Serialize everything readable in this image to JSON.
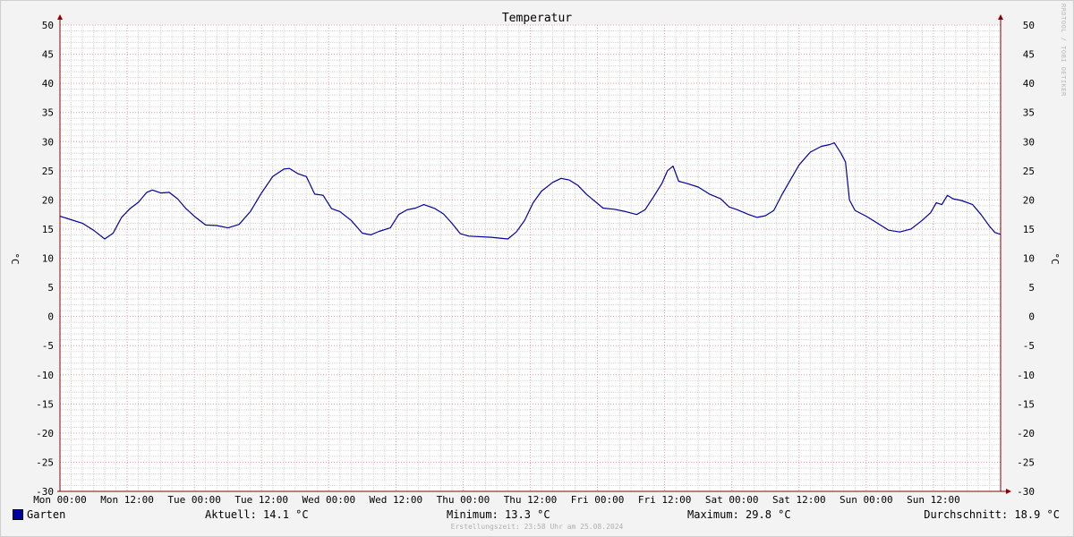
{
  "colors": {
    "background": "#f3f3f3",
    "plot_bg": "#ffffff",
    "line": "#0000a0",
    "grid_major": "#e8a0a0",
    "grid_minor": "#d8d8d8",
    "axis": "#8b0000"
  },
  "credit": "RRDTOOL / TOBI OETIKER",
  "footer": "Erstellungszeit: 23:58 Uhr am 25.08.2024",
  "legend": {
    "series_name": "Garten",
    "current": "Aktuell: 14.1 °C",
    "minimum": "Minimum: 13.3 °C",
    "maximum": "Maximum: 29.8 °C",
    "average": "Durchschnitt: 18.9 °C"
  },
  "chart_data": {
    "type": "line",
    "title": "Temperatur",
    "ylabel_left": "°C",
    "ylabel_right": "°C",
    "ylim": [
      -30,
      50
    ],
    "ytick_step": 5,
    "xlim": [
      0,
      168
    ],
    "x_unit": "hours since Mon 00:00",
    "xticks": [
      {
        "x": 0,
        "label": "Mon 00:00"
      },
      {
        "x": 12,
        "label": "Mon 12:00"
      },
      {
        "x": 24,
        "label": "Tue 00:00"
      },
      {
        "x": 36,
        "label": "Tue 12:00"
      },
      {
        "x": 48,
        "label": "Wed 00:00"
      },
      {
        "x": 60,
        "label": "Wed 12:00"
      },
      {
        "x": 72,
        "label": "Thu 00:00"
      },
      {
        "x": 84,
        "label": "Thu 12:00"
      },
      {
        "x": 96,
        "label": "Fri 00:00"
      },
      {
        "x": 108,
        "label": "Fri 12:00"
      },
      {
        "x": 120,
        "label": "Sat 00:00"
      },
      {
        "x": 132,
        "label": "Sat 12:00"
      },
      {
        "x": 144,
        "label": "Sun 00:00"
      },
      {
        "x": 156,
        "label": "Sun 12:00"
      }
    ],
    "grid": true,
    "series": [
      {
        "name": "Garten",
        "points": [
          [
            0,
            17.2
          ],
          [
            2,
            16.6
          ],
          [
            4,
            16.0
          ],
          [
            6,
            14.8
          ],
          [
            8,
            13.3
          ],
          [
            9.5,
            14.3
          ],
          [
            11,
            17.0
          ],
          [
            12.5,
            18.5
          ],
          [
            14,
            19.6
          ],
          [
            15.5,
            21.3
          ],
          [
            16.5,
            21.7
          ],
          [
            18,
            21.2
          ],
          [
            19.5,
            21.3
          ],
          [
            21,
            20.2
          ],
          [
            22.5,
            18.5
          ],
          [
            24,
            17.2
          ],
          [
            26,
            15.7
          ],
          [
            28,
            15.6
          ],
          [
            30,
            15.2
          ],
          [
            32,
            15.8
          ],
          [
            34,
            18.0
          ],
          [
            36,
            21.2
          ],
          [
            38,
            24.0
          ],
          [
            40,
            25.3
          ],
          [
            41,
            25.4
          ],
          [
            42.5,
            24.5
          ],
          [
            44,
            24.0
          ],
          [
            45.5,
            21.0
          ],
          [
            47,
            20.8
          ],
          [
            48.5,
            18.5
          ],
          [
            50,
            18.0
          ],
          [
            52,
            16.5
          ],
          [
            54,
            14.3
          ],
          [
            55.5,
            14.0
          ],
          [
            57,
            14.6
          ],
          [
            59,
            15.2
          ],
          [
            60.5,
            17.5
          ],
          [
            62,
            18.3
          ],
          [
            63.5,
            18.6
          ],
          [
            65,
            19.2
          ],
          [
            67,
            18.5
          ],
          [
            68.5,
            17.6
          ],
          [
            70,
            16.0
          ],
          [
            71.5,
            14.2
          ],
          [
            73,
            13.8
          ],
          [
            77,
            13.6
          ],
          [
            80,
            13.3
          ],
          [
            81.5,
            14.5
          ],
          [
            83,
            16.5
          ],
          [
            84.5,
            19.5
          ],
          [
            86,
            21.5
          ],
          [
            88,
            23.0
          ],
          [
            89.5,
            23.7
          ],
          [
            91,
            23.4
          ],
          [
            92.5,
            22.5
          ],
          [
            94,
            21.0
          ],
          [
            95.5,
            19.8
          ],
          [
            97,
            18.6
          ],
          [
            99,
            18.4
          ],
          [
            101,
            18.0
          ],
          [
            103,
            17.5
          ],
          [
            104.5,
            18.3
          ],
          [
            106,
            20.5
          ],
          [
            107.5,
            22.8
          ],
          [
            108.5,
            25.0
          ],
          [
            109.5,
            25.8
          ],
          [
            110.5,
            23.2
          ],
          [
            112,
            22.8
          ],
          [
            114,
            22.2
          ],
          [
            116,
            21.0
          ],
          [
            118,
            20.2
          ],
          [
            119.5,
            18.8
          ],
          [
            121,
            18.3
          ],
          [
            123,
            17.5
          ],
          [
            124.5,
            17.0
          ],
          [
            126,
            17.3
          ],
          [
            127.5,
            18.2
          ],
          [
            129,
            21.0
          ],
          [
            130.5,
            23.5
          ],
          [
            132,
            26.0
          ],
          [
            134,
            28.2
          ],
          [
            136,
            29.2
          ],
          [
            137.5,
            29.5
          ],
          [
            138.3,
            29.8
          ],
          [
            139.5,
            28.0
          ],
          [
            140.3,
            26.5
          ],
          [
            141,
            20.0
          ],
          [
            142,
            18.2
          ],
          [
            144,
            17.2
          ],
          [
            146,
            16.0
          ],
          [
            148,
            14.8
          ],
          [
            150,
            14.5
          ],
          [
            152,
            15.0
          ],
          [
            154,
            16.5
          ],
          [
            155.5,
            17.8
          ],
          [
            156.5,
            19.5
          ],
          [
            157.5,
            19.2
          ],
          [
            158.5,
            20.8
          ],
          [
            159.5,
            20.2
          ],
          [
            161,
            19.9
          ],
          [
            163,
            19.2
          ],
          [
            164.5,
            17.5
          ],
          [
            166,
            15.5
          ],
          [
            167,
            14.4
          ],
          [
            168,
            14.1
          ]
        ]
      }
    ]
  }
}
